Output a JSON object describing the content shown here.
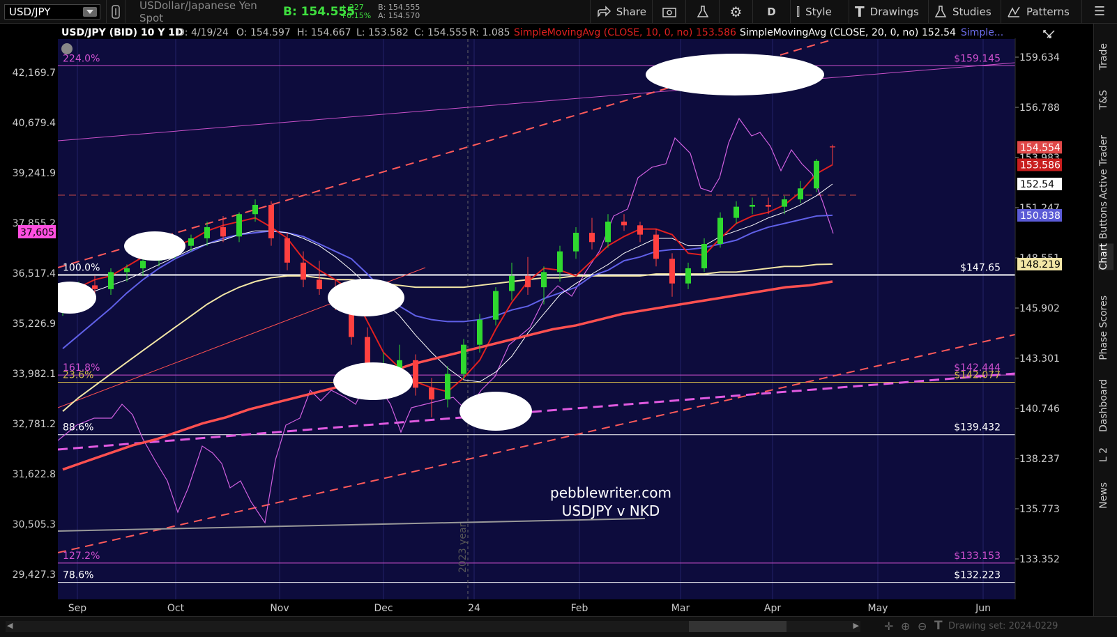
{
  "toolbar": {
    "symbol": "USD/JPY",
    "description": "USDollar/Japanese Yen Spot",
    "bid_big": "B: 154.555",
    "change": "+.227",
    "change_pct": "+0.15%",
    "bid_small": "B: 154.555",
    "ask_small": "A: 154.570",
    "share": "Share",
    "period": "D",
    "style": "Style",
    "drawings": "Drawings",
    "studies": "Studies",
    "patterns": "Patterns"
  },
  "header": {
    "title": "USD/JPY (BID) 10 Y 1D",
    "date": "D: 4/19/24",
    "open": "O: 154.597",
    "high": "H: 154.667",
    "low": "L: 153.582",
    "close": "C: 154.555",
    "range": "R: 1.085",
    "sma10": "SimpleMovingAvg (CLOSE, 10, 0, no)",
    "sma10_value": "153.586",
    "sma20": "SimpleMovingAvg (CLOSE, 20, 0, no)",
    "sma20_value": "152.54",
    "more": "Simple..."
  },
  "side_tabs": [
    "Trade",
    "T&S",
    "Active Trader",
    "Buttons",
    "Chart",
    "Phase Scores",
    "Dashboard",
    "L 2",
    "News"
  ],
  "bottom": {
    "drawing_set": "Drawing set: 2024-0229"
  },
  "watermark": {
    "line1": "pebblewriter.com",
    "line2": "USDJPY v NKD"
  },
  "chart_data": {
    "type": "line",
    "title": "USD/JPY (BID) 10 Y 1D",
    "x_ticks": [
      "Sep",
      "Oct",
      "Nov",
      "Dec",
      "24",
      "Feb",
      "Mar",
      "Apr",
      "May",
      "Jun"
    ],
    "year_marker": "2023 year",
    "y_right_ticks": [
      "159.634",
      "156.788",
      "153.983",
      "151.247",
      "148.551",
      "145.902",
      "143.301",
      "140.746",
      "138.237",
      "135.773",
      "133.352"
    ],
    "y_left_ticks": [
      "42,169.7",
      "40,679.4",
      "39,241.9",
      "37,855.2",
      "36,517.4",
      "35,226.9",
      "33,982.1",
      "32,781.2",
      "31,622.8",
      "30,505.3",
      "29,427.3"
    ],
    "price_labels": [
      {
        "text": "154.554",
        "bg": "#e04848",
        "fg": "#ffffff",
        "price": 154.554
      },
      {
        "text": "153.586",
        "bg": "#c81e1e",
        "fg": "#ffffff",
        "price": 153.586
      },
      {
        "text": "152.54",
        "bg": "#ffffff",
        "fg": "#000000",
        "price": 152.54
      },
      {
        "text": "150.838",
        "bg": "#5b5bd6",
        "fg": "#ffffff",
        "price": 150.838
      },
      {
        "text": "148.219",
        "bg": "#f2e6a6",
        "fg": "#000000",
        "price": 148.219
      }
    ],
    "left_label": {
      "text": "37,605",
      "bg": "#ff4fe0",
      "value": 37605
    },
    "fib_levels": [
      {
        "pct": "224.0%",
        "price_label": "$159.145",
        "price": 159.145,
        "color": "#d050d0"
      },
      {
        "pct": "100.0%",
        "price_label": "$147.65",
        "price": 147.65,
        "color": "#ffffff"
      },
      {
        "pct": "161.8%",
        "price_label": "$142.444",
        "price": 142.444,
        "color": "#d050d0"
      },
      {
        "pct": "23.6%",
        "price_label": "$142.077",
        "price": 142.077,
        "color": "#d4b84a"
      },
      {
        "pct": "88.6%",
        "price_label": "$139.432",
        "price": 139.432,
        "color": "#ffffff"
      },
      {
        "pct": "127.2%",
        "price_label": "$133.153",
        "price": 133.153,
        "color": "#d050d0"
      },
      {
        "pct": "78.6%",
        "price_label": "$132.223",
        "price": 132.223,
        "color": "#ffffff"
      }
    ],
    "sma10": [
      146.2,
      147.0,
      147.4,
      147.6,
      148.1,
      148.6,
      148.9,
      149.2,
      149.5,
      150.0,
      150.3,
      150.5,
      150.7,
      150.2,
      149.6,
      148.5,
      147.9,
      147.4,
      146.8,
      145.2,
      143.6,
      142.8,
      142.1,
      141.8,
      141.6,
      142.3,
      143.2,
      144.8,
      146.2,
      147.3,
      148.0,
      147.9,
      147.6,
      148.4,
      149.2,
      149.7,
      150.1,
      150.1,
      149.8,
      148.8,
      148.7,
      149.6,
      150.4,
      150.8,
      151.0,
      151.4,
      152.1,
      153.1,
      153.59
    ],
    "sma20": [
      145.8,
      146.3,
      146.8,
      147.1,
      147.4,
      147.8,
      148.2,
      148.6,
      149.0,
      149.3,
      149.5,
      149.8,
      150.0,
      150.0,
      149.9,
      149.6,
      149.2,
      148.6,
      147.9,
      147.1,
      146.3,
      145.5,
      144.5,
      143.6,
      142.8,
      142.2,
      142.1,
      142.6,
      143.4,
      144.6,
      145.6,
      146.6,
      147.2,
      147.7,
      148.2,
      148.8,
      149.2,
      149.6,
      149.6,
      149.2,
      149.2,
      149.7,
      150.0,
      150.3,
      150.7,
      151.0,
      151.4,
      151.9,
      152.54
    ],
    "sma50": [
      143.8,
      144.5,
      145.2,
      145.9,
      146.7,
      147.4,
      148.0,
      148.5,
      148.9,
      149.3,
      149.6,
      149.8,
      149.9,
      150.0,
      149.9,
      149.7,
      149.3,
      148.9,
      148.5,
      147.7,
      146.8,
      146.0,
      145.5,
      145.3,
      145.2,
      145.2,
      145.3,
      145.5,
      145.8,
      146.0,
      146.4,
      146.7,
      147.0,
      147.6,
      147.9,
      148.4,
      148.6,
      148.9,
      149.0,
      149.0,
      149.1,
      149.3,
      149.5,
      149.9,
      150.2,
      150.4,
      150.6,
      150.8,
      150.84
    ],
    "sma100": [
      140.6,
      141.3,
      141.9,
      142.5,
      143.1,
      143.7,
      144.3,
      144.9,
      145.5,
      146.1,
      146.6,
      147.0,
      147.3,
      147.5,
      147.6,
      147.6,
      147.5,
      147.4,
      147.4,
      147.3,
      147.2,
      147.1,
      147.0,
      147.0,
      147.0,
      147.0,
      147.1,
      147.2,
      147.3,
      147.4,
      147.5,
      147.5,
      147.6,
      147.6,
      147.6,
      147.6,
      147.6,
      147.7,
      147.7,
      147.7,
      147.7,
      147.8,
      147.8,
      147.9,
      148.0,
      148.1,
      148.1,
      148.2,
      148.22
    ],
    "sma200": [
      137.7,
      138.1,
      138.5,
      138.9,
      139.2,
      139.6,
      140.0,
      140.3,
      140.7,
      141.0,
      141.3,
      141.6,
      141.9,
      142.2,
      142.6,
      143.0,
      143.3,
      143.6,
      143.9,
      144.2,
      144.5,
      144.8,
      145.0,
      145.3,
      145.6,
      145.8,
      146.0,
      146.2,
      146.4,
      146.6,
      146.8,
      147.0,
      147.1,
      147.3
    ],
    "candles_ohlc": [
      [
        145.9,
        146.5,
        145.5,
        146.3
      ],
      [
        146.3,
        147.3,
        146.0,
        147.1
      ],
      [
        147.1,
        147.6,
        146.7,
        146.9
      ],
      [
        146.9,
        148.0,
        146.6,
        147.8
      ],
      [
        147.8,
        148.2,
        147.3,
        148.0
      ],
      [
        148.0,
        148.6,
        147.6,
        148.4
      ],
      [
        148.4,
        149.0,
        148.1,
        148.9
      ],
      [
        148.9,
        149.4,
        148.5,
        149.2
      ],
      [
        149.2,
        149.8,
        148.9,
        149.6
      ],
      [
        149.6,
        150.5,
        149.2,
        150.2
      ],
      [
        150.2,
        150.8,
        149.4,
        149.7
      ],
      [
        149.7,
        151.0,
        149.4,
        150.9
      ],
      [
        150.9,
        151.7,
        150.5,
        151.4
      ],
      [
        151.4,
        151.6,
        149.2,
        149.6
      ],
      [
        149.6,
        149.9,
        147.9,
        148.3
      ],
      [
        148.3,
        148.9,
        147.0,
        147.4
      ],
      [
        147.4,
        148.4,
        146.6,
        146.9
      ],
      [
        146.9,
        147.4,
        145.8,
        146.2
      ],
      [
        146.2,
        146.8,
        144.0,
        144.4
      ],
      [
        144.4,
        144.9,
        141.8,
        142.4
      ],
      [
        142.4,
        143.6,
        141.6,
        142.8
      ],
      [
        142.8,
        144.0,
        142.1,
        143.2
      ],
      [
        143.2,
        143.5,
        141.4,
        141.8
      ],
      [
        141.8,
        142.3,
        140.3,
        141.2
      ],
      [
        141.2,
        142.9,
        140.8,
        142.5
      ],
      [
        142.5,
        144.3,
        142.2,
        144.0
      ],
      [
        144.0,
        145.6,
        143.6,
        145.3
      ],
      [
        145.3,
        147.0,
        145.0,
        146.8
      ],
      [
        146.8,
        148.3,
        146.3,
        147.6
      ],
      [
        147.6,
        148.6,
        146.6,
        147.0
      ],
      [
        147.0,
        148.1,
        146.1,
        147.8
      ],
      [
        147.8,
        149.2,
        147.3,
        148.9
      ],
      [
        148.9,
        150.2,
        148.5,
        149.9
      ],
      [
        149.9,
        150.7,
        149.0,
        149.4
      ],
      [
        149.4,
        150.9,
        149.1,
        150.5
      ],
      [
        150.5,
        150.9,
        150.0,
        150.3
      ],
      [
        150.3,
        150.5,
        149.4,
        149.8
      ],
      [
        149.8,
        150.1,
        148.1,
        148.5
      ],
      [
        148.5,
        148.8,
        146.5,
        147.2
      ],
      [
        147.2,
        148.3,
        146.9,
        148.0
      ],
      [
        148.0,
        149.6,
        147.8,
        149.3
      ],
      [
        149.3,
        151.0,
        149.1,
        150.7
      ],
      [
        150.7,
        151.6,
        150.4,
        151.3
      ],
      [
        151.3,
        151.8,
        150.9,
        151.4
      ],
      [
        151.4,
        151.8,
        150.9,
        151.3
      ],
      [
        151.3,
        151.9,
        150.9,
        151.7
      ],
      [
        151.7,
        152.7,
        151.5,
        152.3
      ],
      [
        152.3,
        153.9,
        152.1,
        153.8
      ],
      [
        154.6,
        154.7,
        153.6,
        154.55
      ]
    ]
  }
}
